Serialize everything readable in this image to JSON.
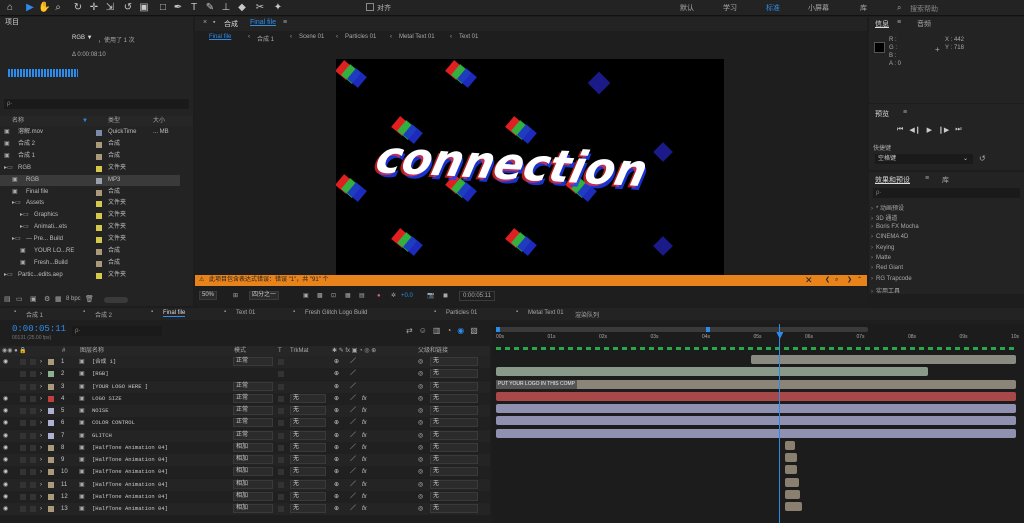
{
  "workspace": {
    "tabs": [
      "默认",
      "学习",
      "标准",
      "小屏幕",
      "库"
    ],
    "active": "标准",
    "search_placeholder": "搜索帮助",
    "snap_label": "对齐"
  },
  "project": {
    "title": "项目",
    "comp_name": "RGB ▼",
    "usage": "，使用了 1 次",
    "duration": "Δ 0:00:08:10",
    "search_placeholder": "ρ·",
    "columns": {
      "name": "名称",
      "type": "类型",
      "size": "大小"
    },
    "items": [
      {
        "name": "溶解.mov",
        "type": "QuickTime",
        "size": "... MB",
        "color": "#7a8aa8",
        "indent": 0
      },
      {
        "name": "合成 2",
        "type": "合成",
        "size": "",
        "color": "#a89a7a",
        "indent": 0
      },
      {
        "name": "合成 1",
        "type": "合成",
        "size": "",
        "color": "#a89a7a",
        "indent": 0
      },
      {
        "name": "RGB",
        "type": "文件夹",
        "size": "",
        "color": "#d4c94a",
        "indent": 0
      },
      {
        "name": "RGB",
        "type": "MP3",
        "size": "",
        "color": "#9aa0a8",
        "indent": 1
      },
      {
        "name": "Final file",
        "type": "合成",
        "size": "",
        "color": "#a89a7a",
        "indent": 1
      },
      {
        "name": "Assets",
        "type": "文件夹",
        "size": "",
        "color": "#d4c94a",
        "indent": 1
      },
      {
        "name": "Graphics",
        "type": "文件夹",
        "size": "",
        "color": "#d4c94a",
        "indent": 2
      },
      {
        "name": "Animati...ets",
        "type": "文件夹",
        "size": "",
        "color": "#d4c94a",
        "indent": 2
      },
      {
        "name": "--- Pre... Build",
        "type": "文件夹",
        "size": "",
        "color": "#d4c94a",
        "indent": 1
      },
      {
        "name": "YOUR LO...RE",
        "type": "合成",
        "size": "",
        "color": "#a89a7a",
        "indent": 2
      },
      {
        "name": "Fresh...Build",
        "type": "合成",
        "size": "",
        "color": "#a89a7a",
        "indent": 2
      },
      {
        "name": "Partic...edits.aep",
        "type": "文件夹",
        "size": "",
        "color": "#d4c94a",
        "indent": 0
      }
    ],
    "bpc": "8 bpc"
  },
  "composition": {
    "panel_title": "合成",
    "comp_tab": "Final file",
    "breadcrumbs": [
      "Final file",
      "合成 1",
      "Scene 01",
      "Particles 01",
      "Metal Text 01",
      "Text 01"
    ],
    "main_text": "connection",
    "warning": "此项目包含表达式错误：错误 \"1\"，共 \"91\" 个",
    "zoom": "50%",
    "resolution": "四分之一",
    "exposure": "+0.0",
    "timecode": "0:00:05:11"
  },
  "info": {
    "title": "信息",
    "audio_tab": "音频",
    "r": "R :",
    "g": "G :",
    "b": "B :",
    "a": "A : 0",
    "x": "X : 442",
    "y": "Y : 718"
  },
  "preview": {
    "title": "预览",
    "shortcut_label": "快捷键",
    "shortcut_value": "空格键"
  },
  "effects": {
    "title": "效果和预设",
    "lib_tab": "库",
    "search_placeholder": "ρ·",
    "items": [
      "* 动画预设",
      "3D 通道",
      "Boris FX Mocha",
      "CINEMA 4D",
      "Keying",
      "Matte",
      "Red Giant",
      "RG Trapcode",
      "实用工具"
    ]
  },
  "timeline": {
    "tabs": [
      "合成 1",
      "合成 2",
      "Final file",
      "Text 01",
      "Fresh Glitch Logo Build",
      "Particles 01",
      "Metal Text 01",
      "渲染队列"
    ],
    "active_tab": "Final file",
    "timecode": "0:00:05:11",
    "frames": "00131 (25.00 fps)",
    "search_placeholder": "ρ·",
    "columns": {
      "num": "#",
      "name": "图层名称",
      "mode": "模式",
      "t": "T",
      "trkmat": "TrkMat",
      "parent": "父级和链接"
    },
    "ruler": [
      "00s",
      "01s",
      "02s",
      "03s",
      "04s",
      "05s",
      "06s",
      "07s",
      "08s",
      "09s",
      "10s"
    ],
    "layers": [
      {
        "num": "1",
        "name": "[合成 1]",
        "mode": "正常",
        "trk": "",
        "parent": "无",
        "color": "#a89a7a",
        "bar_start": 0.49,
        "bar_end": 1.0,
        "bar_color": "#8a8a80",
        "bar_label": ""
      },
      {
        "num": "2",
        "name": "[RGB]",
        "mode": "",
        "trk": "",
        "parent": "无",
        "color": "#8fb08f",
        "bar_start": 0.0,
        "bar_end": 0.83,
        "bar_color": "#8a9a8a",
        "bar_label": ""
      },
      {
        "num": "3",
        "name": "[YOUR LOGO HERE ]",
        "mode": "正常",
        "trk": "",
        "parent": "无",
        "color": "#a89a7a",
        "bar_start": 0.0,
        "bar_end": 1.0,
        "bar_color": "#8a8578",
        "bar_label": "PUT YOUR LOGO IN THIS COMP"
      },
      {
        "num": "4",
        "name": "LOGO SIZE",
        "mode": "正常",
        "trk": "无",
        "parent": "无",
        "color": "#c04040",
        "bar_start": 0.0,
        "bar_end": 1.0,
        "bar_color": "#a84848",
        "bar_label": ""
      },
      {
        "num": "5",
        "name": "NOISE",
        "mode": "正常",
        "trk": "无",
        "parent": "无",
        "color": "#b0b0d0",
        "bar_start": 0.0,
        "bar_end": 1.0,
        "bar_color": "#9090b0",
        "bar_label": ""
      },
      {
        "num": "6",
        "name": "COLOR CONTROL",
        "mode": "正常",
        "trk": "无",
        "parent": "无",
        "color": "#b0b0d0",
        "bar_start": 0.0,
        "bar_end": 1.0,
        "bar_color": "#9090b0",
        "bar_label": ""
      },
      {
        "num": "7",
        "name": "GLITCH",
        "mode": "正常",
        "trk": "无",
        "parent": "无",
        "color": "#b0b0d0",
        "bar_start": 0.0,
        "bar_end": 1.0,
        "bar_color": "#9090b0",
        "bar_label": ""
      },
      {
        "num": "8",
        "name": "[HalfTone Animation 04]",
        "mode": "相加",
        "trk": "无",
        "parent": "无",
        "color": "#a89a7a",
        "bar_start": 0.555,
        "bar_end": 0.575,
        "bar_color": "#8a8070",
        "bar_label": ""
      },
      {
        "num": "9",
        "name": "[HalfTone Animation 04]",
        "mode": "相加",
        "trk": "无",
        "parent": "无",
        "color": "#a89a7a",
        "bar_start": 0.555,
        "bar_end": 0.578,
        "bar_color": "#8a8070",
        "bar_label": ""
      },
      {
        "num": "10",
        "name": "[HalfTone Animation 04]",
        "mode": "相加",
        "trk": "无",
        "parent": "无",
        "color": "#a89a7a",
        "bar_start": 0.555,
        "bar_end": 0.578,
        "bar_color": "#8a8070",
        "bar_label": ""
      },
      {
        "num": "11",
        "name": "[HalfTone Animation 04]",
        "mode": "相加",
        "trk": "无",
        "parent": "无",
        "color": "#a89a7a",
        "bar_start": 0.556,
        "bar_end": 0.582,
        "bar_color": "#8a8070",
        "bar_label": ""
      },
      {
        "num": "12",
        "name": "[HalfTone Animation 04]",
        "mode": "相加",
        "trk": "无",
        "parent": "无",
        "color": "#a89a7a",
        "bar_start": 0.556,
        "bar_end": 0.585,
        "bar_color": "#8a8070",
        "bar_label": ""
      },
      {
        "num": "13",
        "name": "[HalfTone Animation 04]",
        "mode": "相加",
        "trk": "无",
        "parent": "无",
        "color": "#a89a7a",
        "bar_start": 0.556,
        "bar_end": 0.588,
        "bar_color": "#8a8070",
        "bar_label": ""
      }
    ],
    "playhead": 0.545
  }
}
